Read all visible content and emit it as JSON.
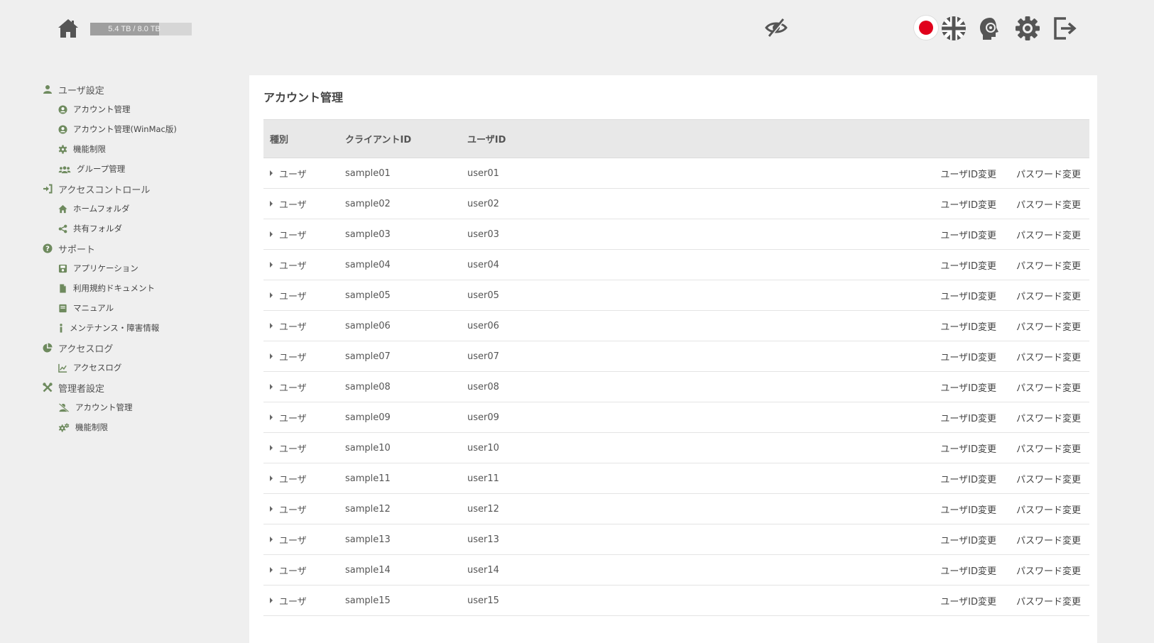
{
  "header": {
    "storage_text": "5.4 TB / 8.0 TB",
    "storage_fraction": 0.675,
    "icons": [
      "home-icon",
      "hide-eye-icon",
      "japanese-flag-icon",
      "english-flag-icon",
      "support-icon",
      "gear-icon",
      "logout-icon"
    ]
  },
  "sidebar": {
    "sections": [
      {
        "label": "ユーザ設定",
        "icon": "user-icon",
        "items": [
          {
            "label": "アカウント管理",
            "icon": "user-circle-icon"
          },
          {
            "label": "アカウント管理(WinMac版)",
            "icon": "user-circle-icon"
          },
          {
            "label": "機能制限",
            "icon": "gear-icon"
          },
          {
            "label": "グループ管理",
            "icon": "users-icon"
          }
        ]
      },
      {
        "label": "アクセスコントロール",
        "icon": "sign-in-icon",
        "items": [
          {
            "label": "ホームフォルダ",
            "icon": "home-icon"
          },
          {
            "label": "共有フォルダ",
            "icon": "share-icon"
          }
        ]
      },
      {
        "label": "サポート",
        "icon": "question-icon",
        "items": [
          {
            "label": "アプリケーション",
            "icon": "save-icon"
          },
          {
            "label": "利用規約ドキュメント",
            "icon": "file-icon"
          },
          {
            "label": "マニュアル",
            "icon": "book-icon"
          },
          {
            "label": "メンテナンス・障害情報",
            "icon": "info-icon"
          }
        ]
      },
      {
        "label": "アクセスログ",
        "icon": "pie-chart-icon",
        "items": [
          {
            "label": "アクセスログ",
            "icon": "line-chart-icon"
          }
        ]
      },
      {
        "label": "管理者設定",
        "icon": "tools-icon",
        "items": [
          {
            "label": "アカウント管理",
            "icon": "user-slash-icon"
          },
          {
            "label": "機能制限",
            "icon": "gears-icon"
          }
        ]
      }
    ]
  },
  "main": {
    "title": "アカウント管理",
    "columns": [
      "種別",
      "クライアントID",
      "ユーザID"
    ],
    "rows": [
      {
        "type": "ユーザ",
        "client_id": "sample01",
        "user_id": "user01"
      },
      {
        "type": "ユーザ",
        "client_id": "sample02",
        "user_id": "user02"
      },
      {
        "type": "ユーザ",
        "client_id": "sample03",
        "user_id": "user03"
      },
      {
        "type": "ユーザ",
        "client_id": "sample04",
        "user_id": "user04"
      },
      {
        "type": "ユーザ",
        "client_id": "sample05",
        "user_id": "user05"
      },
      {
        "type": "ユーザ",
        "client_id": "sample06",
        "user_id": "user06"
      },
      {
        "type": "ユーザ",
        "client_id": "sample07",
        "user_id": "user07"
      },
      {
        "type": "ユーザ",
        "client_id": "sample08",
        "user_id": "user08"
      },
      {
        "type": "ユーザ",
        "client_id": "sample09",
        "user_id": "user09"
      },
      {
        "type": "ユーザ",
        "client_id": "sample10",
        "user_id": "user10"
      },
      {
        "type": "ユーザ",
        "client_id": "sample11",
        "user_id": "user11"
      },
      {
        "type": "ユーザ",
        "client_id": "sample12",
        "user_id": "user12"
      },
      {
        "type": "ユーザ",
        "client_id": "sample13",
        "user_id": "user13"
      },
      {
        "type": "ユーザ",
        "client_id": "sample14",
        "user_id": "user14"
      },
      {
        "type": "ユーザ",
        "client_id": "sample15",
        "user_id": "user15"
      }
    ],
    "row_actions": {
      "change_user_id": "ユーザID変更",
      "change_password": "パスワード変更"
    }
  },
  "colors": {
    "accent_green": "#6e8a5e",
    "icon_gray": "#555555",
    "flag_red": "#e0001b"
  }
}
